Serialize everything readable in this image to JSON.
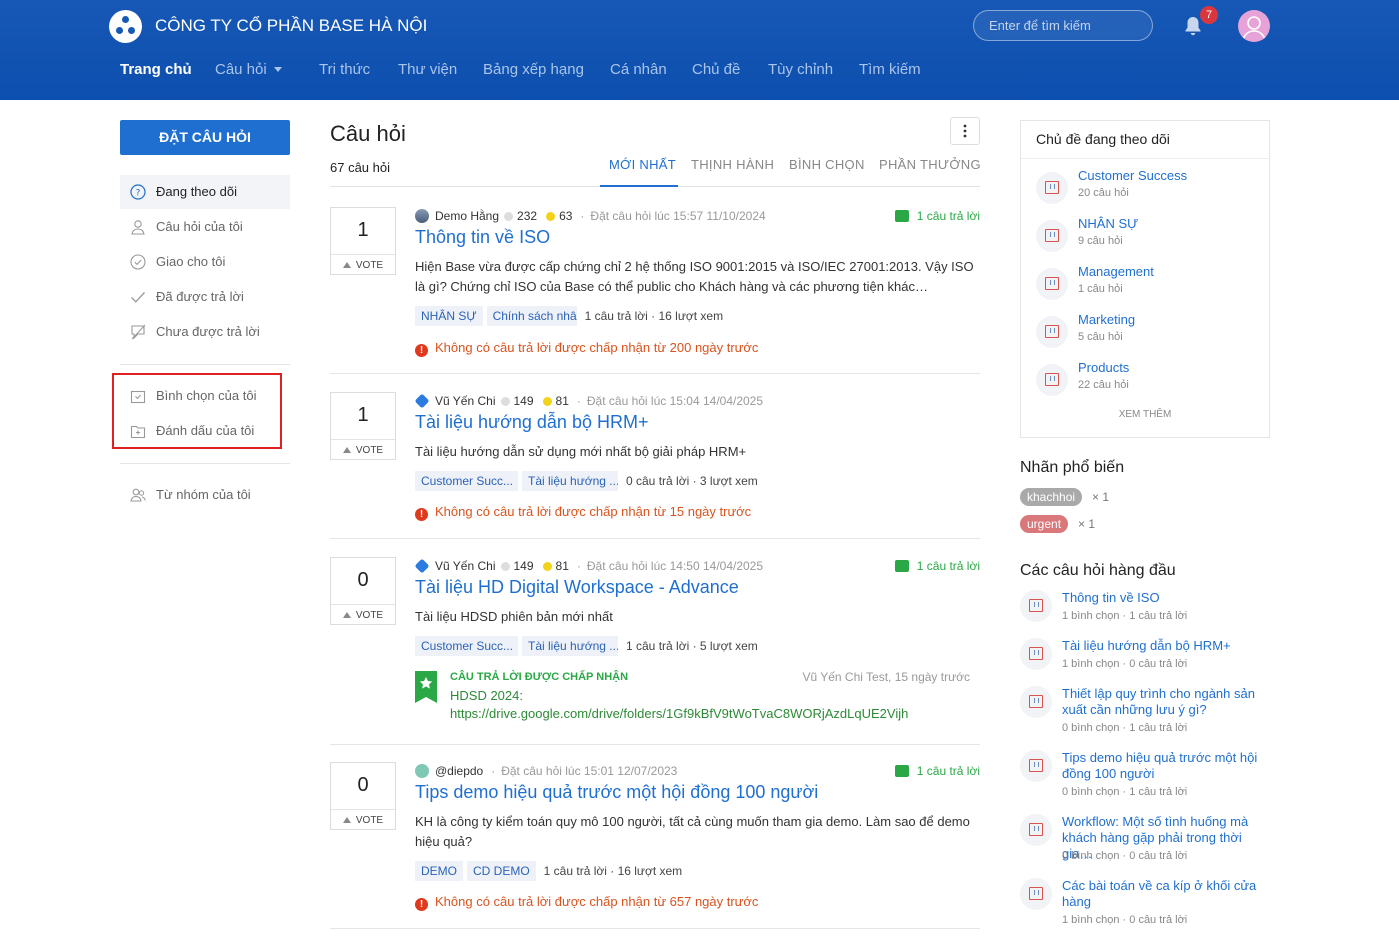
{
  "header": {
    "company": "CÔNG TY CỔ PHẦN BASE HÀ NỘI",
    "search_placeholder": "Enter để tìm kiếm",
    "notification_count": "7",
    "nav": [
      "Trang chủ",
      "Câu hỏi",
      "Tri thức",
      "Thư viện",
      "Bảng xếp hạng",
      "Cá nhân",
      "Chủ đề",
      "Tùy chỉnh",
      "Tìm kiếm"
    ]
  },
  "sidebar": {
    "ask_button": "ĐẶT CÂU HỎI",
    "items": [
      "Đang theo dõi",
      "Câu hỏi của tôi",
      "Giao cho tôi",
      "Đã được trả lời",
      "Chưa được trả lời",
      "Bình chọn của tôi",
      "Đánh dấu của tôi",
      "Từ nhóm của tôi"
    ]
  },
  "main": {
    "title": "Câu hỏi",
    "count_num": "67",
    "count_suffix": " câu hỏi",
    "tabs": [
      "MỚI NHẤT",
      "THỊNH HÀNH",
      "BÌNH CHỌN",
      "PHẦN THƯỞNG"
    ],
    "vote_label": "VOTE",
    "questions": [
      {
        "votes": "1",
        "user": "Demo Hằng",
        "points1": "232",
        "points2": "63",
        "asked": "Đặt câu hỏi lúc 15:57 11/10/2024",
        "answers": "1 câu trả lời",
        "title": "Thông tin về ISO",
        "desc": "Hiện Base vừa được cấp chứng chỉ 2 hệ thống ISO 9001:2015 và ISO/IEC 27001:2013. Vậy ISO là gì? Chứng chỉ ISO của Base có thể public cho Khách hàng và các phương tiện khác…",
        "tags": [
          "NHÂN SỰ",
          "Chính sách nhâ..."
        ],
        "stats": "1 câu trả lời · 16 lượt xem",
        "warning": "Không có câu trả lời được chấp nhận từ 200 ngày trước"
      },
      {
        "votes": "1",
        "user": "Vũ Yến Chi",
        "points1": "149",
        "points2": "81",
        "asked": "Đặt câu hỏi lúc 15:04 14/04/2025",
        "answers": "",
        "title": "Tài liệu hướng dẫn bộ HRM+",
        "desc": "Tài liệu hướng dẫn sử dụng mới nhất bộ giải pháp HRM+",
        "tags": [
          "Customer Succ...",
          "Tài liệu hướng ..."
        ],
        "stats": "0 câu trả lời · 3 lượt xem",
        "warning": "Không có câu trả lời được chấp nhận từ 15 ngày trước"
      },
      {
        "votes": "0",
        "user": "Vũ Yến Chi",
        "points1": "149",
        "points2": "81",
        "asked": "Đặt câu hỏi lúc 14:50 14/04/2025",
        "answers": "1 câu trả lời",
        "title": "Tài liệu HD Digital Workspace - Advance",
        "desc": "Tài liệu HDSD phiên bản mới nhất",
        "tags": [
          "Customer Succ...",
          "Tài liệu hướng ..."
        ],
        "stats": "1 câu trả lời · 5 lượt xem",
        "accepted_label": "CÂU TRẢ LỜI ĐƯỢC CHẤP NHẬN",
        "accepted_by": "Vũ Yến Chi Test, 15 ngày trước",
        "accepted_line1": "HDSD 2024:",
        "accepted_line2": "https://drive.google.com/drive/folders/1Gf9kBfV9tWoTvaC8WORjAzdLqUE2Vijh"
      },
      {
        "votes": "0",
        "user": "@diepdo",
        "asked": "Đặt câu hỏi lúc 15:01 12/07/2023",
        "answers": "1 câu trả lời",
        "title": "Tips demo hiệu quả trước một hội đồng 100 người",
        "desc": "KH là công ty kiểm toán quy mô 100 người, tất cả cùng muốn tham gia demo. Làm sao để demo hiệu quả?",
        "tags": [
          "DEMO",
          "CD DEMO"
        ],
        "stats": "1 câu trả lời · 16 lượt xem",
        "warning": "Không có câu trả lời được chấp nhận từ 657 ngày trước"
      }
    ]
  },
  "right": {
    "followed_title": "Chủ đề đang theo dõi",
    "topics": [
      {
        "name": "Customer Success",
        "count": "20 câu hỏi"
      },
      {
        "name": "NHÂN SỰ",
        "count": "9 câu hỏi"
      },
      {
        "name": "Management",
        "count": "1 câu hỏi"
      },
      {
        "name": "Marketing",
        "count": "5 câu hỏi"
      },
      {
        "name": "Products",
        "count": "22 câu hỏi"
      }
    ],
    "view_more": "XEM THÊM",
    "labels_title": "Nhãn phổ biến",
    "labels": [
      {
        "name": "khachhoi",
        "count": "× 1",
        "color": "#a9a9a9"
      },
      {
        "name": "urgent",
        "count": "× 1",
        "color": "#d9777a"
      }
    ],
    "top_title": "Các câu hỏi hàng đầu",
    "top_questions": [
      {
        "title": "Thông tin về ISO",
        "stats": "1 bình chọn · 1 câu trả lời"
      },
      {
        "title": "Tài liệu hướng dẫn bộ HRM+",
        "stats": "1 bình chọn · 0 câu trả lời"
      },
      {
        "title": "Thiết lập quy trình cho ngành sản xuất cần những lưu ý gì?",
        "stats": "0 bình chọn · 1 câu trả lời"
      },
      {
        "title": "Tips demo hiệu quả trước một hội đồng 100 người",
        "stats": "0 bình chọn · 1 câu trả lời"
      },
      {
        "title": "Workflow: Một số tình huống mà khách hàng gặp phải trong thời gia…",
        "stats": "0 bình chọn · 0 câu trả lời"
      },
      {
        "title": "Các bài toán về ca kíp ở khối cửa hàng",
        "stats": "1 bình chọn · 0 câu trả lời"
      }
    ]
  },
  "colors": {
    "header": "#1758b6",
    "accent": "#1f6fd1",
    "success": "#2aa845",
    "warning": "#d9531e",
    "highlight_box": "#e02020"
  }
}
